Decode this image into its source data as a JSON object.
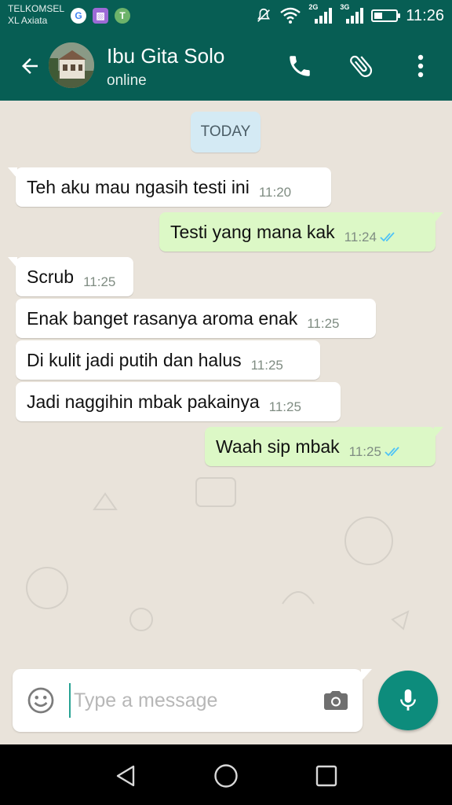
{
  "status_bar": {
    "carrier_1": "TELKOMSEL",
    "carrier_2": "XL Axiata",
    "net_1": "2G",
    "net_2": "3G",
    "time": "11:26",
    "battery_level": 0.4
  },
  "header": {
    "contact_name": "Ibu Gita Solo",
    "contact_status": "online"
  },
  "chat": {
    "date_label": "TODAY",
    "messages": [
      {
        "direction": "in",
        "text": "Teh aku mau ngasih testi ini",
        "time": "11:20"
      },
      {
        "direction": "out",
        "text": "Testi yang mana kak",
        "time": "11:24",
        "status": "read"
      },
      {
        "direction": "in",
        "text": "Scrub",
        "time": "11:25"
      },
      {
        "direction": "in",
        "text": "Enak banget rasanya aroma enak",
        "time": "11:25"
      },
      {
        "direction": "in",
        "text": "Di kulit jadi putih dan halus",
        "time": "11:25"
      },
      {
        "direction": "in",
        "text": "Jadi naggihin mbak pakainya",
        "time": "11:25"
      },
      {
        "direction": "out",
        "text": "Waah sip mbak",
        "time": "11:25",
        "status": "read"
      }
    ]
  },
  "composer": {
    "placeholder": "Type a message",
    "value": ""
  },
  "colors": {
    "primary": "#075e54",
    "accent": "#0d8c7c",
    "outgoing_bubble": "#dcf8c6",
    "read_ticks": "#4fc3f7"
  },
  "icons": [
    "back-arrow-icon",
    "phone-icon",
    "attach-icon",
    "more-vert-icon",
    "emoji-icon",
    "camera-icon",
    "mic-icon",
    "nav-back-icon",
    "nav-home-icon",
    "nav-recents-icon"
  ]
}
